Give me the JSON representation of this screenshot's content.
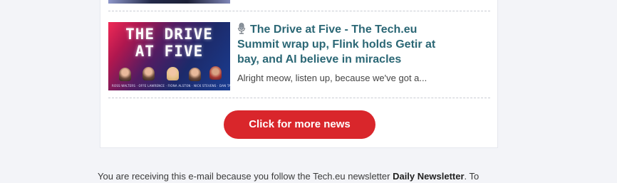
{
  "article": {
    "thumbnail_title": "THE DRIVE\nAT FIVE",
    "thumbnail_caption": "ROSS WALTERS · OFFE LAWRENCE · FIONA ALSTON · NICK STEVENS · DAN TAYLOR",
    "headline": "The Drive at Five - The Tech.eu Summit wrap up, Flink holds Getir at bay, and AI believe in miracles",
    "excerpt": "Alright meow, listen up, because we've got a..."
  },
  "cta": {
    "label": "Click for more news"
  },
  "footer": {
    "text_before": "You are receiving this e-mail because you follow the Tech.eu newsletter ",
    "newsletter_name": "Daily Newsletter",
    "text_after": ". To"
  },
  "colors": {
    "headline": "#2b6775",
    "cta_background": "#d9262b",
    "page_background": "#f3f4f8"
  },
  "icons": {
    "headline_prefix": "microphone-icon"
  }
}
